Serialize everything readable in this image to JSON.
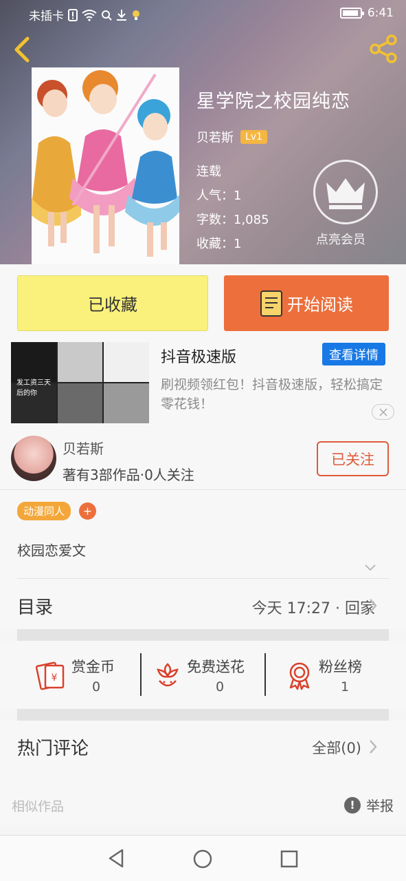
{
  "status_bar": {
    "carrier": "未插卡",
    "time": "6:41"
  },
  "book": {
    "title": "星学院之校园纯恋",
    "author": "贝若斯",
    "level": "Lv1",
    "status": "连载",
    "popularity": "人气：1",
    "word_count": "字数：1,085",
    "favorites": "收藏：1",
    "vip_label": "点亮会员"
  },
  "actions": {
    "collected_label": "已收藏",
    "read_label": "开始阅读"
  },
  "ad": {
    "title": "抖音极速版",
    "detail_button": "查看详情",
    "description": "刷视频领红包！抖音极速版，轻松搞定零花钱！",
    "thumb_caption": "发工资三天后的你"
  },
  "author_card": {
    "name": "贝若斯",
    "stats": "著有3部作品·0人关注",
    "follow_label": "已关注"
  },
  "tags": {
    "items": [
      "动漫同人"
    ],
    "add": "+"
  },
  "description": "校园恋爱文",
  "catalog": {
    "title": "目录",
    "latest": "今天 17:27 · 回家"
  },
  "reward_bar": [
    {
      "label": "赏金币",
      "value": "0",
      "icon": "red-envelope-icon"
    },
    {
      "label": "免费送花",
      "value": "0",
      "icon": "flower-icon"
    },
    {
      "label": "粉丝榜",
      "value": "1",
      "icon": "medal-icon"
    }
  ],
  "comments": {
    "title": "热门评论",
    "all": "全部(0)"
  },
  "similar": {
    "title": "相似作品",
    "report": "举报",
    "report_icon": "!"
  },
  "colors": {
    "accent": "#ec6f3c",
    "collect": "#faf17c",
    "ad_button": "#1879e6",
    "level_badge": "#f5b642",
    "icon_red": "#d9412c"
  }
}
